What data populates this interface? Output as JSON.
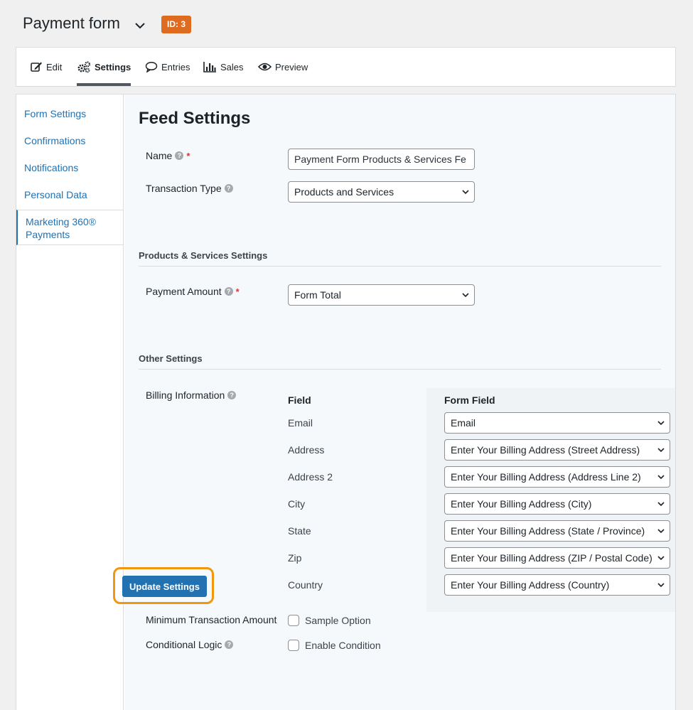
{
  "header": {
    "title": "Payment form",
    "id_badge": "ID: 3",
    "badge_color": "#dd6b20"
  },
  "tabs": [
    {
      "label": "Edit",
      "icon": "edit-icon"
    },
    {
      "label": "Settings",
      "icon": "gears-icon",
      "active": true
    },
    {
      "label": "Entries",
      "icon": "speech-bubble-icon"
    },
    {
      "label": "Sales",
      "icon": "bar-chart-icon"
    },
    {
      "label": "Preview",
      "icon": "eye-icon"
    }
  ],
  "sidebar": {
    "items": [
      {
        "label": "Form Settings"
      },
      {
        "label": "Confirmations"
      },
      {
        "label": "Notifications"
      },
      {
        "label": "Personal Data"
      },
      {
        "label": "Marketing 360® Payments",
        "active": true
      }
    ]
  },
  "feed": {
    "title": "Feed Settings",
    "name_label": "Name",
    "name_value": "Payment Form Products & Services Fe",
    "transaction_type_label": "Transaction Type",
    "transaction_type_value": "Products and Services",
    "products_section": "Products & Services Settings",
    "payment_amount_label": "Payment Amount",
    "payment_amount_value": "Form Total",
    "other_section": "Other Settings",
    "billing_label": "Billing Information",
    "billing_field_header": "Field",
    "billing_form_field_header": "Form Field",
    "billing_rows": [
      {
        "field": "Email",
        "value": "Email"
      },
      {
        "field": "Address",
        "value": "Enter Your Billing Address (Street Address)"
      },
      {
        "field": "Address 2",
        "value": "Enter Your Billing Address (Address Line 2)"
      },
      {
        "field": "City",
        "value": "Enter Your Billing Address (City)"
      },
      {
        "field": "State",
        "value": "Enter Your Billing Address (State / Province)"
      },
      {
        "field": "Zip",
        "value": "Enter Your Billing Address (ZIP / Postal Code)"
      },
      {
        "field": "Country",
        "value": "Enter Your Billing Address (Country)"
      }
    ],
    "min_amount_label": "Minimum Transaction Amount",
    "min_amount_option": "Sample Option",
    "conditional_label": "Conditional Logic",
    "conditional_option": "Enable Condition",
    "update_button": "Update Settings"
  },
  "colors": {
    "link": "#2271b1",
    "primary_button": "#2271b1",
    "highlight": "#f0960f",
    "required": "#d63638"
  }
}
